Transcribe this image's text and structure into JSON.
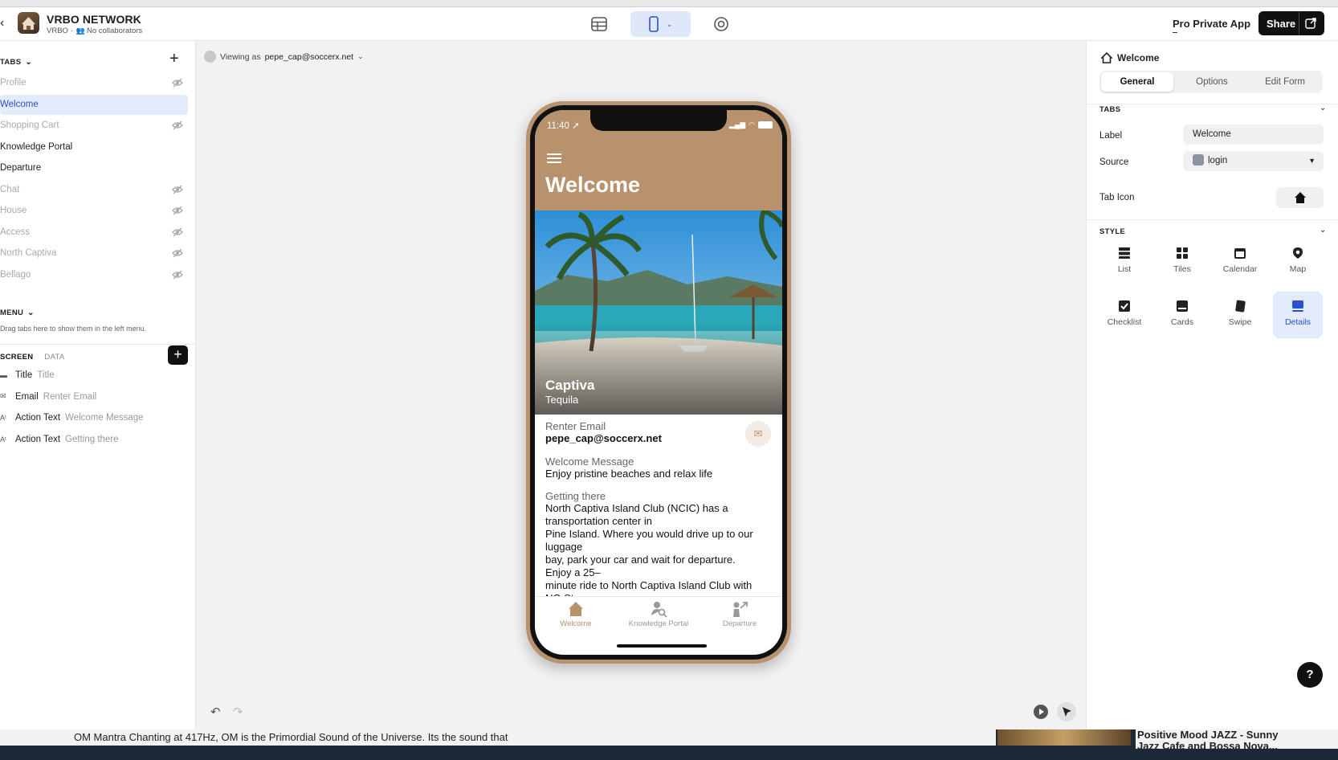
{
  "app": {
    "title": "VRBO NETWORK",
    "owner": "VRBO",
    "collaborators": "No collaborators",
    "plan_label": "Pro Private App",
    "share_label": "Share"
  },
  "left": {
    "tabs_header": "TABS",
    "tabs": [
      {
        "label": "Profile",
        "hidden": true
      },
      {
        "label": "Welcome",
        "hidden": false,
        "active": true
      },
      {
        "label": "Shopping Cart",
        "hidden": true
      },
      {
        "label": "Knowledge Portal",
        "hidden": false
      },
      {
        "label": "Departure",
        "hidden": false
      },
      {
        "label": "Chat",
        "hidden": true
      },
      {
        "label": "House",
        "hidden": true
      },
      {
        "label": "Access",
        "hidden": true
      },
      {
        "label": "North Captiva",
        "hidden": true
      },
      {
        "label": "Bellago",
        "hidden": true
      }
    ],
    "menu_header": "MENU",
    "menu_hint": "Drag tabs here to show them in the left menu.",
    "screen_tab": "SCREEN",
    "data_tab": "DATA",
    "components": [
      {
        "icon": "title-icon",
        "name": "Title",
        "value": "Title"
      },
      {
        "icon": "email-icon",
        "name": "Email",
        "value": "Renter Email"
      },
      {
        "icon": "action-text-icon",
        "name": "Action Text",
        "value": "Welcome Message"
      },
      {
        "icon": "action-text-icon",
        "name": "Action Text",
        "value": "Getting there"
      }
    ]
  },
  "canvas": {
    "viewing_as_label": "Viewing as",
    "viewing_as_user": "pepe_cap@soccerx.net"
  },
  "phone": {
    "time": "11:40",
    "title": "Welcome",
    "hero_title": "Captiva",
    "hero_subtitle": "Tequila",
    "fields": [
      {
        "label": "Renter Email",
        "value": "pepe_cap@soccerx.net"
      },
      {
        "label": "Welcome Message",
        "value": "Enjoy pristine beaches and relax life"
      },
      {
        "label": "Getting there",
        "lines": [
          "North Captiva Island Club (NCIC) has a",
          "transportation center in",
          "Pine Island. Where you would drive up to our",
          "luggage",
          "bay, park your car and wait for departure.",
          "Enjoy a 25–",
          "minute ride to North Captiva Island Club with",
          "NO Stops."
        ]
      }
    ],
    "nav": [
      "Welcome",
      "Knowledge Portal",
      "Departure"
    ],
    "accent": "#b8916d"
  },
  "right": {
    "title": "Welcome",
    "tabs": [
      "General",
      "Options",
      "Edit Form"
    ],
    "tabs_section": "TABS",
    "label_name": "Label",
    "label_value": "Welcome",
    "source_name": "Source",
    "source_value": "login",
    "tab_icon_name": "Tab Icon",
    "style_section": "STYLE",
    "styles": [
      "List",
      "Tiles",
      "Calendar",
      "Map",
      "Checklist",
      "Cards",
      "Swipe",
      "Details"
    ],
    "selected_style": "Details"
  },
  "background": {
    "left_text": "OM Mantra Chanting at 417Hz, OM is the Primordial Sound of the Universe. Its the sound that",
    "right_text_1": "Positive Mood JAZZ - Sunny",
    "right_text_2": "Jazz Cafe and Bossa Nova..."
  },
  "colors": {
    "accent_blue": "#2a4fd1",
    "selected_bg": "#e3ebfc",
    "phone_brown": "#b8916d"
  }
}
